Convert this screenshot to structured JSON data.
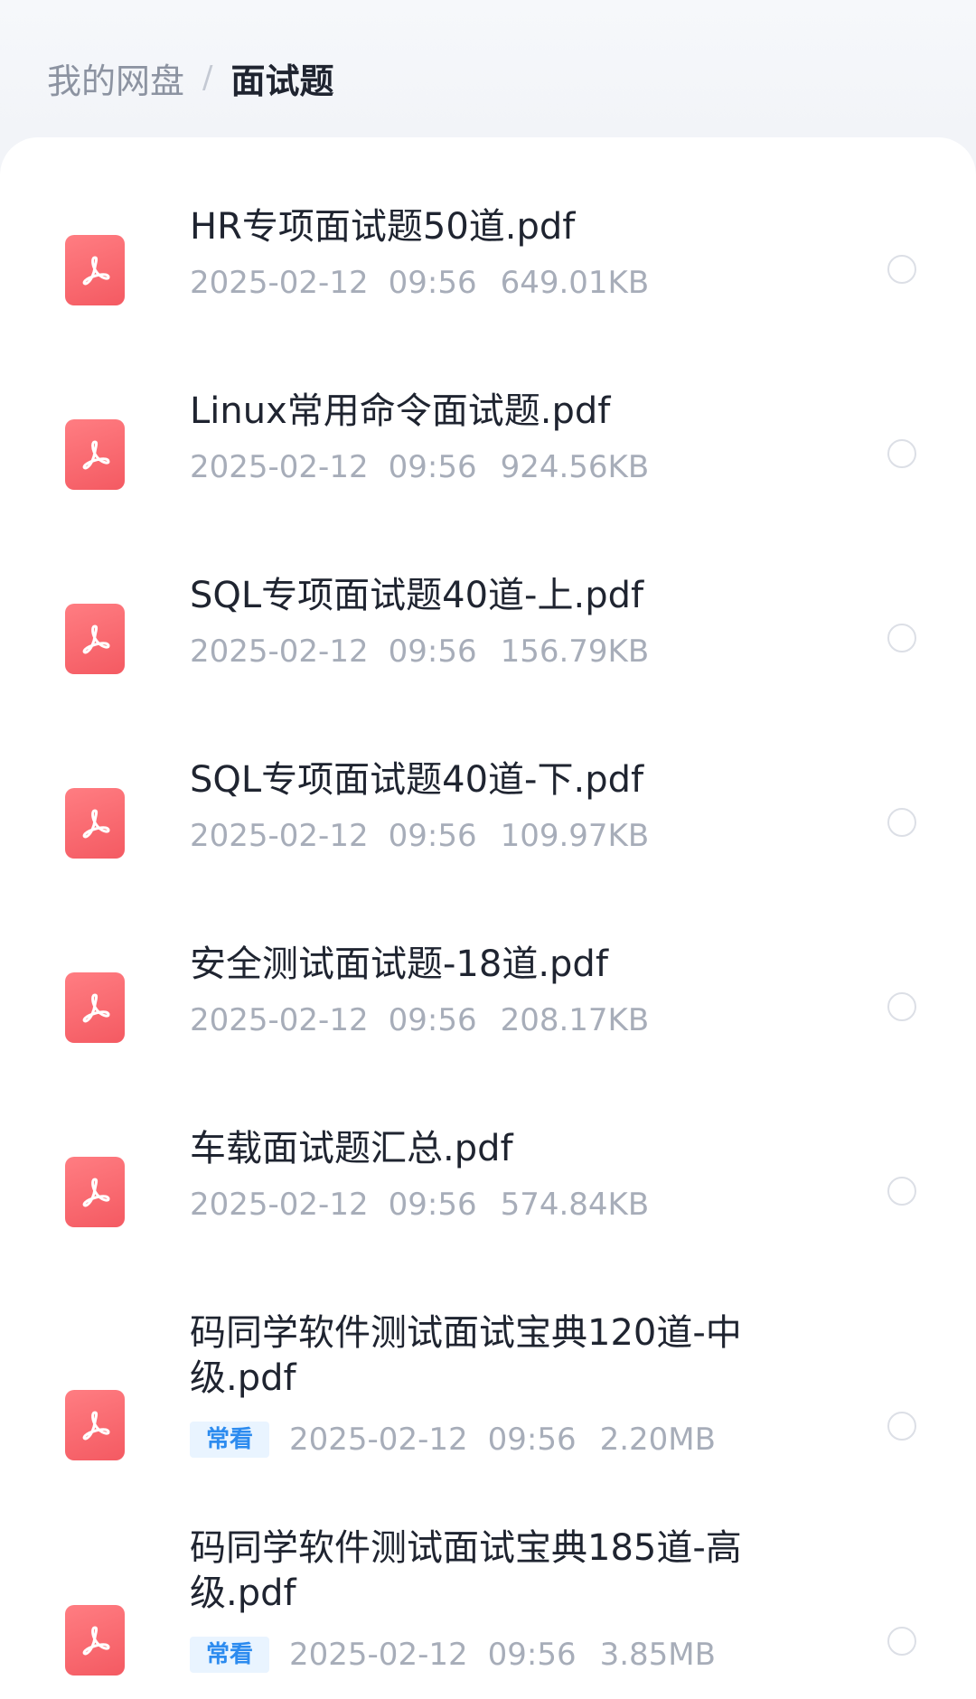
{
  "breadcrumb": {
    "root": "我的网盘",
    "separator": "/",
    "current": "面试题"
  },
  "colors": {
    "pdf_icon": "#f45a62",
    "tag_bg": "#e9f4ff",
    "tag_text": "#2c8bef",
    "meta_text": "#a7adb9"
  },
  "files": [
    {
      "name": "HR专项面试题50道.pdf",
      "date": "2025-02-12",
      "time": "09:56",
      "size": "649.01KB",
      "tag": "",
      "icon": "pdf-icon"
    },
    {
      "name": "Linux常用命令面试题.pdf",
      "date": "2025-02-12",
      "time": "09:56",
      "size": "924.56KB",
      "tag": "",
      "icon": "pdf-icon"
    },
    {
      "name": "SQL专项面试题40道-上.pdf",
      "date": "2025-02-12",
      "time": "09:56",
      "size": "156.79KB",
      "tag": "",
      "icon": "pdf-icon"
    },
    {
      "name": "SQL专项面试题40道-下.pdf",
      "date": "2025-02-12",
      "time": "09:56",
      "size": "109.97KB",
      "tag": "",
      "icon": "pdf-icon"
    },
    {
      "name": "安全测试面试题-18道.pdf",
      "date": "2025-02-12",
      "time": "09:56",
      "size": "208.17KB",
      "tag": "",
      "icon": "pdf-icon"
    },
    {
      "name": "车载面试题汇总.pdf",
      "date": "2025-02-12",
      "time": "09:56",
      "size": "574.84KB",
      "tag": "",
      "icon": "pdf-icon"
    },
    {
      "name": "码同学软件测试面试宝典120道-中级.pdf",
      "date": "2025-02-12",
      "time": "09:56",
      "size": "2.20MB",
      "tag": "常看",
      "icon": "pdf-icon"
    },
    {
      "name": "码同学软件测试面试宝典185道-高级.pdf",
      "date": "2025-02-12",
      "time": "09:56",
      "size": "3.85MB",
      "tag": "常看",
      "icon": "pdf-icon"
    }
  ]
}
